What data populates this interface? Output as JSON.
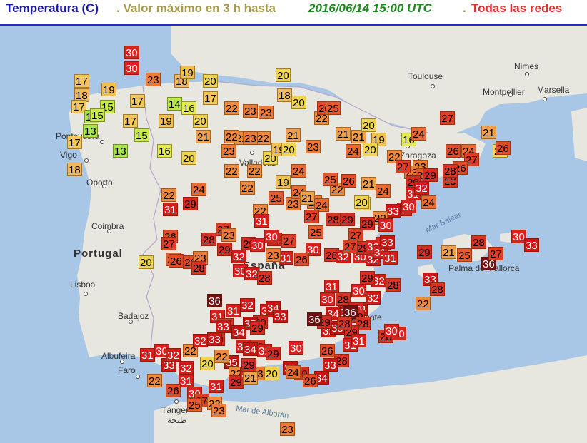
{
  "header": {
    "variable": "Temperatura (C)",
    "description": ". Valor máximo en 3 h hasta ",
    "datetime": "2016/06/14 15:00 UTC",
    "sep": ". ",
    "network": "Todas las redes",
    "colors": {
      "variable": "#1a1aa8",
      "description": "#a89a4a",
      "datetime": "#1a8a1a",
      "network": "#e03030"
    }
  },
  "map_labels": {
    "countries": [
      "Portugal",
      "España"
    ],
    "cities": [
      "Toulouse",
      "Nimes",
      "Montpellier",
      "Marsella",
      "Pontevedra",
      "Vigo",
      "Oporto",
      "Coimbra",
      "Lisboa",
      "Badajoz",
      "Albufeira",
      "Faro",
      "Palma de Mallorca",
      "Alicante",
      "Tánger",
      "طنجة",
      "Valladolid",
      "Zaragoza"
    ],
    "seas": [
      "Mar Balear",
      "Mar de Alborán"
    ]
  },
  "color_scale": {
    "13": "#a8e64a",
    "14": "#b8e84a",
    "15": "#c8ec4a",
    "16": "#e4ec4a",
    "17": "#f2c85a",
    "18": "#f2b85c",
    "19": "#f0c04a",
    "20": "#f0d44a",
    "21": "#f0a04a",
    "22": "#f08a3a",
    "23": "#ee7a34",
    "24": "#ec6a30",
    "25": "#e85a2c",
    "26": "#e44a28",
    "27": "#e03c26",
    "28": "#dc3224",
    "29": "#d82a22",
    "30": "#e02020",
    "31": "#dc1c1c",
    "32": "#d81818",
    "33": "#d41414",
    "34": "#cc1212",
    "35": "#c01010",
    "36": "#701010"
  },
  "stations": [
    {
      "v": 17
    },
    {
      "v": 19
    },
    {
      "v": 19
    },
    {
      "v": 17
    },
    {
      "v": 18
    },
    {
      "v": 19
    },
    {
      "v": 17
    },
    {
      "v": 15
    },
    {
      "v": 17
    },
    {
      "v": 13
    },
    {
      "v": 15
    },
    {
      "v": 17
    },
    {
      "v": 15
    },
    {
      "v": 13
    },
    {
      "v": 14
    },
    {
      "v": 16
    },
    {
      "v": 13
    },
    {
      "v": 17
    },
    {
      "v": 18
    },
    {
      "v": 20
    },
    {
      "v": 21
    },
    {
      "v": 20
    },
    {
      "v": 19
    },
    {
      "v": 16
    },
    {
      "v": 18
    },
    {
      "v": 19
    },
    {
      "v": 17
    },
    {
      "v": 20
    },
    {
      "v": 21
    },
    {
      "v": 22
    },
    {
      "v": 23
    },
    {
      "v": 22
    },
    {
      "v": 20
    },
    {
      "v": 20
    },
    {
      "v": 18
    },
    {
      "v": 20
    },
    {
      "v": 19
    },
    {
      "v": 22
    },
    {
      "v": 23
    },
    {
      "v": 20
    },
    {
      "v": 21
    },
    {
      "v": 24
    },
    {
      "v": 23
    },
    {
      "v": 22
    },
    {
      "v": 26
    },
    {
      "v": 25
    },
    {
      "v": 21
    },
    {
      "v": 21
    },
    {
      "v": 20
    },
    {
      "v": 19
    },
    {
      "v": 16
    },
    {
      "v": 24
    },
    {
      "v": 27
    },
    {
      "v": 26
    },
    {
      "v": 24
    },
    {
      "v": 21
    },
    {
      "v": 20
    },
    {
      "v": 22
    },
    {
      "v": 23
    },
    {
      "v": 22
    },
    {
      "v": 22
    },
    {
      "v": 24
    },
    {
      "v": 23
    },
    {
      "v": 22
    },
    {
      "v": 24
    },
    {
      "v": 20
    },
    {
      "v": 22
    },
    {
      "v": 23
    },
    {
      "v": 23
    },
    {
      "v": 23
    },
    {
      "v": 22
    },
    {
      "v": 19
    },
    {
      "v": 22
    },
    {
      "v": 25
    },
    {
      "v": 23
    },
    {
      "v": 24
    },
    {
      "v": 21
    },
    {
      "v": 24
    },
    {
      "v": 25
    },
    {
      "v": 20
    },
    {
      "v": 21
    },
    {
      "v": 24
    },
    {
      "v": 27
    },
    {
      "v": 25
    },
    {
      "v": 28
    },
    {
      "v": 27
    },
    {
      "v": 26
    },
    {
      "v": 28
    },
    {
      "v": 29
    },
    {
      "v": 29
    },
    {
      "v": 30
    },
    {
      "v": 31
    },
    {
      "v": 32
    },
    {
      "v": 28
    },
    {
      "v": 33
    },
    {
      "v": 30
    },
    {
      "v": 24
    },
    {
      "v": 20
    },
    {
      "v": 29
    },
    {
      "v": 22
    },
    {
      "v": 27
    },
    {
      "v": 25
    },
    {
      "v": 28
    },
    {
      "v": 26
    },
    {
      "v": 27
    },
    {
      "v": 30
    },
    {
      "v": 30
    },
    {
      "v": 31
    },
    {
      "v": 29
    },
    {
      "v": 29
    },
    {
      "v": 31
    },
    {
      "v": 27
    },
    {
      "v": 30
    },
    {
      "v": 27
    },
    {
      "v": 24
    },
    {
      "v": 29
    },
    {
      "v": 22
    },
    {
      "v": 31
    },
    {
      "v": 26
    },
    {
      "v": 27
    },
    {
      "v": 25
    },
    {
      "v": 26
    },
    {
      "v": 23
    },
    {
      "v": 20
    },
    {
      "v": 26
    },
    {
      "v": 28
    },
    {
      "v": 28
    },
    {
      "v": 23
    },
    {
      "v": 30
    },
    {
      "v": 30
    },
    {
      "v": 31
    },
    {
      "v": 32
    },
    {
      "v": 30
    },
    {
      "v": 32
    },
    {
      "v": 28
    },
    {
      "v": 23
    },
    {
      "v": 26
    },
    {
      "v": 28
    },
    {
      "v": 32
    },
    {
      "v": 30
    },
    {
      "v": 32
    },
    {
      "v": 29
    },
    {
      "v": 27
    },
    {
      "v": 29
    },
    {
      "v": 30
    },
    {
      "v": 31
    },
    {
      "v": 33
    },
    {
      "v": 31
    },
    {
      "v": 32
    },
    {
      "v": 28
    },
    {
      "v": 29
    },
    {
      "v": 30
    },
    {
      "v": 31
    },
    {
      "v": 30
    },
    {
      "v": 28
    },
    {
      "v": 34
    },
    {
      "v": 32
    },
    {
      "v": 30
    },
    {
      "v": 29
    },
    {
      "v": 33
    },
    {
      "v": 34
    },
    {
      "v": 32
    },
    {
      "v": 36
    },
    {
      "v": 28
    },
    {
      "v": 29
    },
    {
      "v": 31
    },
    {
      "v": 35
    },
    {
      "v": 28
    },
    {
      "v": 29
    },
    {
      "v": 36
    },
    {
      "v": 33
    },
    {
      "v": 34
    },
    {
      "v": 33
    },
    {
      "v": 29
    },
    {
      "v": 32
    },
    {
      "v": 35
    },
    {
      "v": 36
    },
    {
      "v": 31
    },
    {
      "v": 29
    },
    {
      "v": 28
    },
    {
      "v": 31
    },
    {
      "v": 28
    },
    {
      "v": 31
    },
    {
      "v": 33
    },
    {
      "v": 29
    },
    {
      "v": 34
    },
    {
      "v": 22
    },
    {
      "v": 32
    },
    {
      "v": 33
    },
    {
      "v": 35
    },
    {
      "v": 34
    },
    {
      "v": 31
    },
    {
      "v": 29
    },
    {
      "v": 30
    },
    {
      "v": 34
    },
    {
      "v": 29
    },
    {
      "v": 34
    },
    {
      "v": 28
    },
    {
      "v": 26
    },
    {
      "v": 33
    },
    {
      "v": 31
    },
    {
      "v": 28
    },
    {
      "v": 30
    },
    {
      "v": 29
    },
    {
      "v": 33
    },
    {
      "v": 28
    },
    {
      "v": 22
    },
    {
      "v": 21
    },
    {
      "v": 25
    },
    {
      "v": 28
    },
    {
      "v": 36
    },
    {
      "v": 27
    },
    {
      "v": 30
    },
    {
      "v": 33
    },
    {
      "v": 26
    },
    {
      "v": 30
    },
    {
      "v": 23
    },
    {
      "v": 22
    },
    {
      "v": 31
    },
    {
      "v": 30
    },
    {
      "v": 31
    },
    {
      "v": 22
    },
    {
      "v": 26
    },
    {
      "v": 27
    },
    {
      "v": 25
    },
    {
      "v": 22
    },
    {
      "v": 23
    },
    {
      "v": 29
    },
    {
      "v": 30
    },
    {
      "v": 21
    },
    {
      "v": 20
    },
    {
      "v": 24
    },
    {
      "v": 26
    },
    {
      "v": 23
    },
    {
      "v": 20
    },
    {
      "v": 22
    },
    {
      "v": 29
    },
    {
      "v": 33
    },
    {
      "v": 30
    },
    {
      "v": 32
    },
    {
      "v": 31
    },
    {
      "v": 32
    },
    {
      "v": 30
    },
    {
      "v": 30
    },
    {
      "v": 23
    }
  ]
}
